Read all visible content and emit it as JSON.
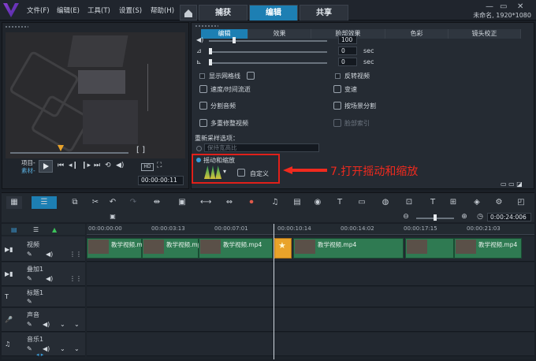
{
  "titlebar": {
    "menu": [
      "文件(F)",
      "编辑(E)",
      "工具(T)",
      "设置(S)",
      "帮助(H)"
    ],
    "tabs": [
      "捕获",
      "编辑",
      "共享"
    ],
    "active_tab": "编辑",
    "project_info": "未命名, 1920*1080"
  },
  "preview": {
    "mode_project": "项目-",
    "mode_clip": "素材-",
    "timecode": "00:00:00:11",
    "marker_brackets": "[ ]",
    "hd_badge": "HD"
  },
  "options": {
    "tabs": [
      "编辑",
      "效果",
      "脸部效果",
      "色彩",
      "镜头校正"
    ],
    "active_tab": "编辑",
    "volume_value": "100",
    "fade_in_value": "0",
    "fade_out_value": "0",
    "unit": "sec",
    "show_grid": "显示网格线",
    "reverse_video": "反转视频",
    "speed_time": "速度/时间流逝",
    "variable_speed": "变速",
    "split_audio": "分割音频",
    "split_by_scene": "按场景分割",
    "multi_trim": "多重修整视频",
    "face_index": "脸部索引",
    "resample_label": "重新采样选项：",
    "resample_value": "保持宽高比",
    "pan_zoom_label": "摇动和缩放",
    "customize": "自定义"
  },
  "annotation": "7.打开摇动和缩放",
  "timeline": {
    "ruler_ticks": [
      "00:00:00:00",
      "00:00:03:13",
      "00:00:07:01",
      "00:00:10:14",
      "00:00:14:02",
      "00:00:17:15",
      "00:00:21:03"
    ],
    "zoom_timecode": "0:00:24:006",
    "tracks": [
      "视频",
      "叠加1",
      "标题1",
      "声音",
      "音乐1"
    ],
    "clip_name": "教学视频.mp4"
  },
  "colors": {
    "accent": "#1d7fb3",
    "clip_green": "#2f7a52",
    "annotation_red": "#e0201a"
  }
}
